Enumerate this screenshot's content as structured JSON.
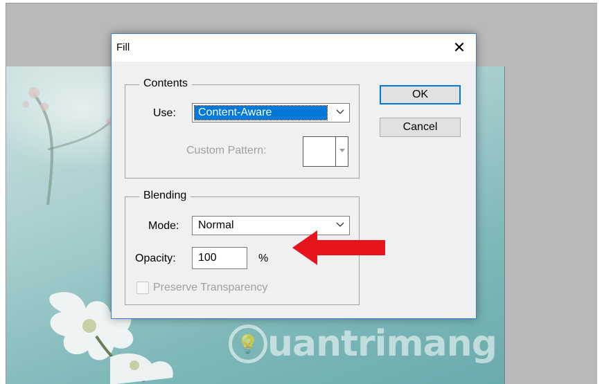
{
  "dialog": {
    "title": "Fill",
    "close_glyph": "✕",
    "contents": {
      "legend": "Contents",
      "use_label": "Use:",
      "use_value": "Content-Aware",
      "custom_pattern_label": "Custom Pattern:"
    },
    "blending": {
      "legend": "Blending",
      "mode_label": "Mode:",
      "mode_value": "Normal",
      "opacity_label": "Opacity:",
      "opacity_value": "100",
      "opacity_unit": "%",
      "preserve_label": "Preserve Transparency",
      "preserve_checked": false
    },
    "buttons": {
      "ok": "OK",
      "cancel": "Cancel"
    }
  },
  "watermark": {
    "text": "uantrimang"
  },
  "colors": {
    "accent": "#0078d7",
    "arrow": "#e8141c",
    "dialog_border": "#3b7bcc"
  }
}
